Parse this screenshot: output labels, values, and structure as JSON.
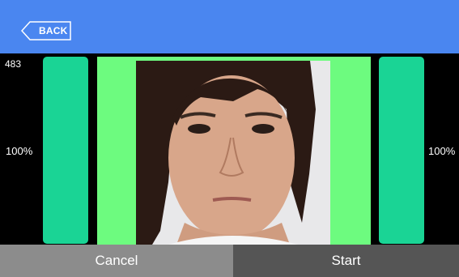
{
  "header": {
    "back_label": "BACK"
  },
  "camera": {
    "count_text": "483",
    "left_level_text": "100%",
    "right_level_text": "100%",
    "left_level": 1.0,
    "right_level": 1.0
  },
  "footer": {
    "cancel_label": "Cancel",
    "start_label": "Start"
  },
  "colors": {
    "header": "#4a86f0",
    "level_bar": "#1ad495",
    "face_frame": "#6dfb7f",
    "cancel_button": "#8c8c8c",
    "start_button": "#555555"
  }
}
